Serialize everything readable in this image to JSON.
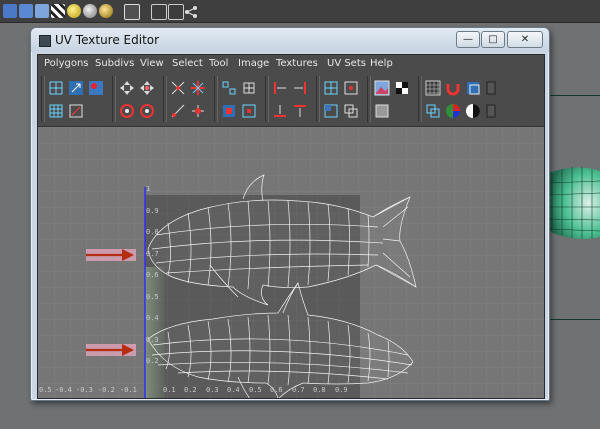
{
  "window": {
    "title": "UV Texture Editor",
    "controls": {
      "minimize": "—",
      "maximize": "□",
      "close": "✕"
    }
  },
  "menu": [
    "Polygons",
    "Subdivs",
    "View",
    "Select",
    "Tool",
    "Image",
    "Textures",
    "UV Sets",
    "Help"
  ],
  "uv_axis": {
    "u_labels": [
      "0.5",
      "-0.4",
      "-0.3",
      "-0.2",
      "-0.1",
      "0.1",
      "0.2",
      "0.3",
      "0.4",
      "0.5",
      "0.6",
      "0.7",
      "0.8",
      "0.9"
    ],
    "v_labels": [
      "1",
      "0.9",
      "0.8",
      "0.7",
      "0.6",
      "0.5",
      "0.4",
      "0.3",
      "0.2"
    ]
  },
  "colors": {
    "accent_blue": "#2a2aff",
    "arrow_red": "#c23a1a",
    "mesh_white": "#f2f2f2",
    "highlight_pink": "#e8a7c0"
  }
}
